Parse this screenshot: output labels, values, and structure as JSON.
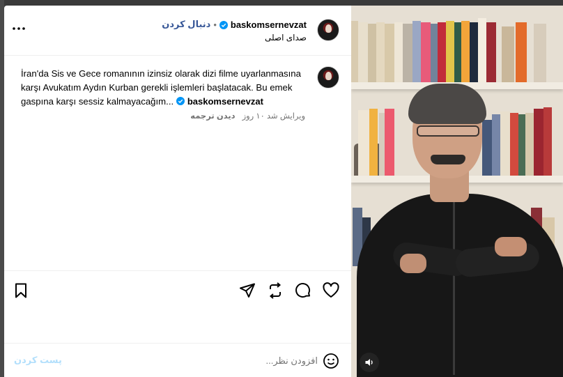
{
  "post": {
    "username": "baskomsernevzat",
    "follow_label": "دنبال کردن",
    "separator": "•",
    "audio_label": "صدای اصلی"
  },
  "caption": {
    "username": "baskomsernevzat",
    "text": "İran'da Sis ve Gece romanının izinsiz olarak dizi filme uyarlanmasına karşı Avukatım Aydın Kurban gerekli işlemleri başlatacak. Bu emek gaspına karşı sessiz kalmayacağım...",
    "edited_label": "ویرایش شد ۱۰ روز",
    "translate_label": "دیدن ترجمه"
  },
  "comment": {
    "placeholder": "افزودن نظر...",
    "post_label": "پست کردن"
  },
  "icons": {
    "more": "more-options-icon",
    "verified": "verified-badge-icon",
    "save": "bookmark-icon",
    "share": "send-icon",
    "repost": "repost-icon",
    "comment": "comment-bubble-icon",
    "like": "heart-icon",
    "emoji": "emoji-icon",
    "mute": "speaker-icon"
  },
  "colors": {
    "verified": "#0095f6",
    "follow": "#385898",
    "post_button_disabled": "#b2dffc",
    "muted_text": "#737373"
  }
}
